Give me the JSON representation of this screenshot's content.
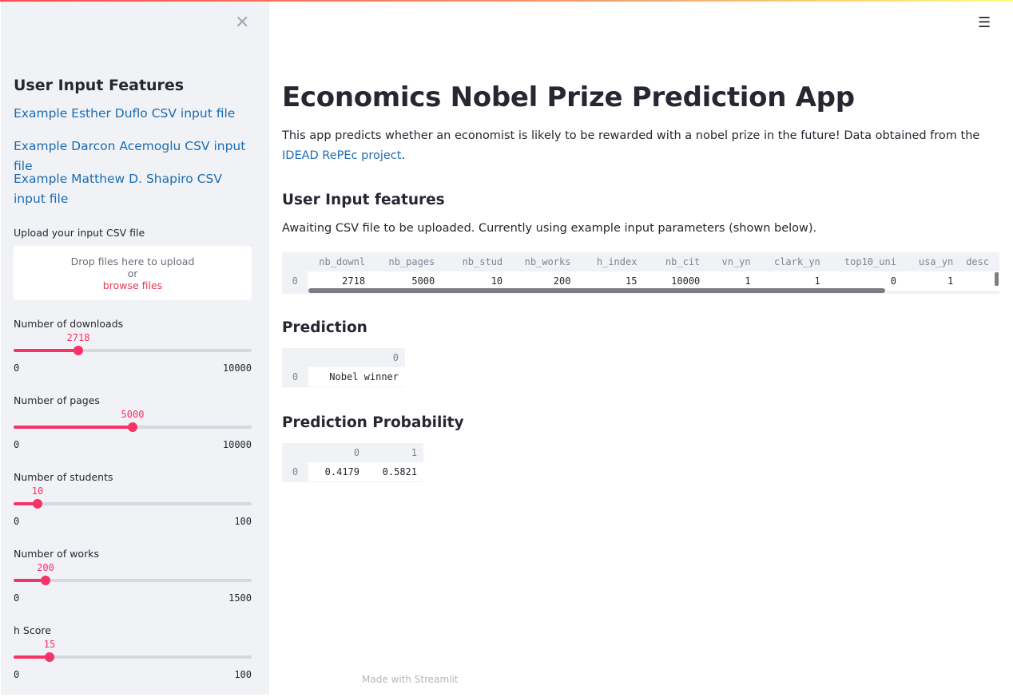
{
  "sidebar": {
    "title": "User Input Features",
    "links": [
      "Example Esther Duflo CSV input file",
      "Example Darcon Acemoglu CSV input file",
      "Example Matthew D. Shapiro CSV input file"
    ],
    "upload_label": "Upload your input CSV file",
    "dropzone": {
      "line1": "Drop files here to upload",
      "line2": "or",
      "browse": "browse files"
    },
    "sliders": [
      {
        "label": "Number of downloads",
        "value": "2718",
        "min": "0",
        "max": "10000",
        "fraction": 0.2718
      },
      {
        "label": "Number of pages",
        "value": "5000",
        "min": "0",
        "max": "10000",
        "fraction": 0.5
      },
      {
        "label": "Number of students",
        "value": "10",
        "min": "0",
        "max": "100",
        "fraction": 0.1
      },
      {
        "label": "Number of works",
        "value": "200",
        "min": "0",
        "max": "1500",
        "fraction": 0.1333
      },
      {
        "label": "h Score",
        "value": "15",
        "min": "0",
        "max": "100",
        "fraction": 0.15
      }
    ]
  },
  "main": {
    "title": "Economics Nobel Prize Prediction App",
    "description": "This app predicts whether an economist is likely to be rewarded with a nobel prize in the future! Data obtained from the",
    "link_text": "IDEAD RePEc project",
    "link_suffix": ".",
    "input_header": "User Input features",
    "awaiting_text": "Awaiting CSV file to be uploaded. Currently using example input parameters (shown below).",
    "input_table": {
      "columns": [
        "nb_downl",
        "nb_pages",
        "nb_stud",
        "nb_works",
        "h_index",
        "nb_cit",
        "vn_yn",
        "clark_yn",
        "top10_uni",
        "usa_yn",
        "desc"
      ],
      "rows": [
        {
          "index": "0",
          "cells": [
            "2718",
            "5000",
            "10",
            "200",
            "15",
            "10000",
            "1",
            "1",
            "0",
            "1",
            ""
          ]
        }
      ]
    },
    "prediction_header": "Prediction",
    "prediction_table": {
      "columns": [
        "0"
      ],
      "rows": [
        {
          "index": "0",
          "cells": [
            "Nobel winner"
          ]
        }
      ]
    },
    "probability_header": "Prediction Probability",
    "probability_table": {
      "columns": [
        "0",
        "1"
      ],
      "rows": [
        {
          "index": "0",
          "cells": [
            "0.4179",
            "0.5821"
          ]
        }
      ]
    },
    "footer": "Made with Streamlit"
  },
  "colors": {
    "accent": "#f63366",
    "link": "#1c6cb2",
    "sidebar_bg": "#f0f2f6"
  },
  "icons": {
    "close": "close-icon",
    "menu": "hamburger-menu-icon"
  }
}
